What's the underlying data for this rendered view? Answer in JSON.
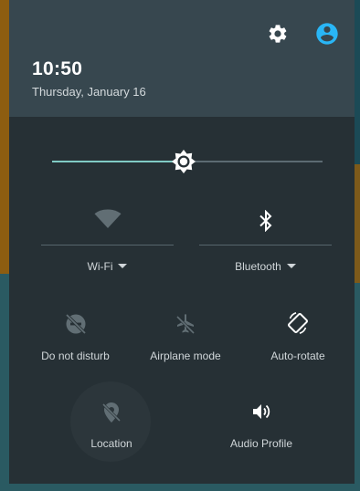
{
  "header": {
    "time": "10:50",
    "date": "Thursday, January 16",
    "settings_icon": "gear-icon",
    "account_icon": "account-circle-icon"
  },
  "brightness": {
    "icon": "brightness-icon",
    "level": 0.49
  },
  "tiles": {
    "wifi": {
      "label": "Wi-Fi",
      "icon": "wifi-icon",
      "state": "off"
    },
    "bluetooth": {
      "label": "Bluetooth",
      "icon": "bluetooth-icon",
      "state": "on"
    },
    "do_not_disturb": {
      "label": "Do not disturb",
      "icon": "do-not-disturb-off-icon",
      "state": "off"
    },
    "airplane_mode": {
      "label": "Airplane mode",
      "icon": "airplane-off-icon",
      "state": "off"
    },
    "auto_rotate": {
      "label": "Auto-rotate",
      "icon": "screen-rotation-icon",
      "state": "on"
    },
    "location": {
      "label": "Location",
      "icon": "location-off-icon",
      "state": "off"
    },
    "audio_profile": {
      "label": "Audio Profile",
      "icon": "volume-icon",
      "state": "on"
    }
  },
  "colors": {
    "header_bg": "#37474f",
    "panel_bg": "#263035",
    "accent": "#29b6f6",
    "slider_accent": "#80cbc4"
  }
}
